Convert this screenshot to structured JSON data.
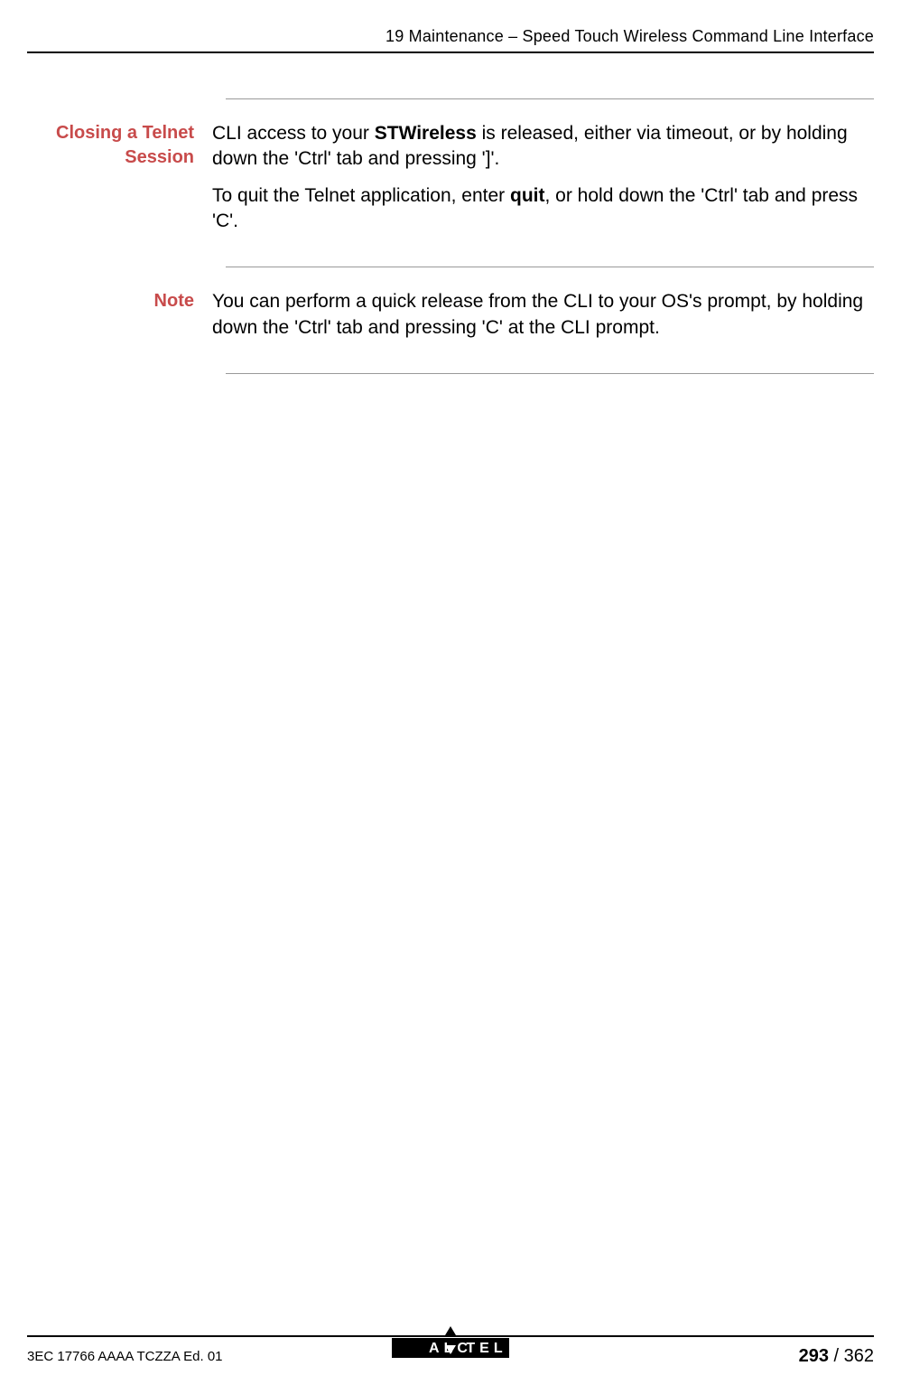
{
  "header": {
    "title": "19 Maintenance – Speed Touch Wireless Command Line Interface"
  },
  "section1": {
    "label": "Closing a Telnet Session",
    "p1_pre": "CLI access to your ",
    "p1_strong": "STWireless",
    "p1_post": " is released, either via timeout, or by holding down the 'Ctrl' tab and pressing ']'.",
    "p2_pre": "To quit the Telnet application, enter ",
    "p2_strong": "quit",
    "p2_post": ", or hold down the 'Ctrl' tab and press 'C'."
  },
  "section2": {
    "label": "Note",
    "p1": "You can perform a quick release from the CLI to your OS's prompt, by holding down the 'Ctrl' tab and pressing 'C' at the CLI prompt."
  },
  "footer": {
    "doc_id": "3EC 17766 AAAA TCZZA Ed. 01",
    "page_current": "293",
    "page_total": "362"
  }
}
